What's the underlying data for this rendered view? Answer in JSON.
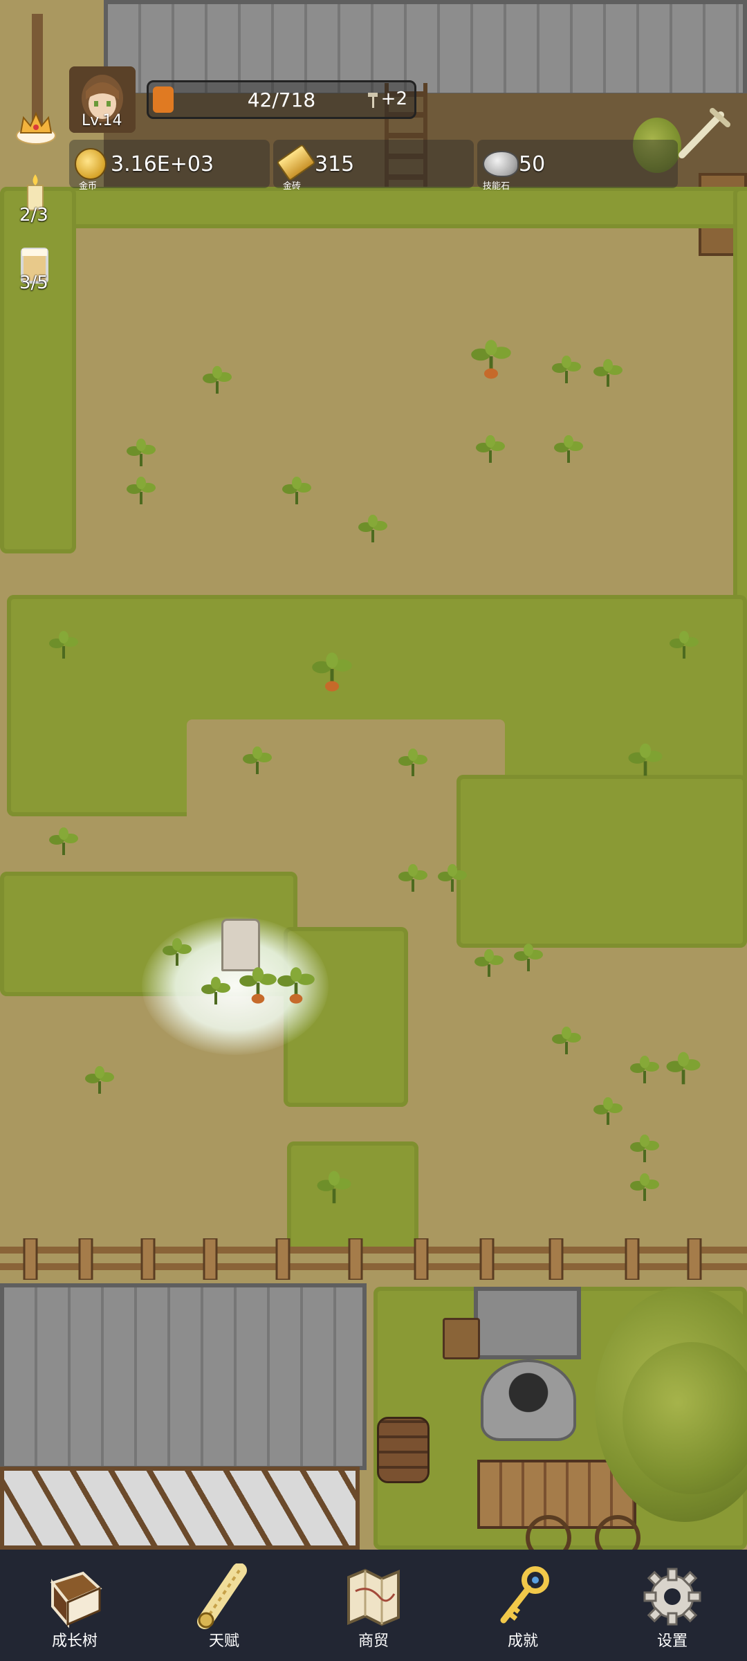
{
  "player": {
    "level_label": "Lv.14",
    "xp_text": "42/718",
    "xp_progress": 0.0585,
    "bonus_text": "+2"
  },
  "resources": [
    {
      "icon": "gold-coin-icon",
      "value": "3.16E+03",
      "caption": "金币"
    },
    {
      "icon": "gold-brick-icon",
      "value": "315",
      "caption": "金砖"
    },
    {
      "icon": "skill-stone-icon",
      "value": "50",
      "caption": "技能石"
    }
  ],
  "side_counters": [
    {
      "icon": "crown-icon"
    },
    {
      "icon": "candle-icon",
      "value": "2/3"
    },
    {
      "icon": "beer-mug-icon",
      "value": "3/5"
    }
  ],
  "nav": [
    {
      "icon": "book-icon",
      "label": "成长树"
    },
    {
      "icon": "scroll-icon",
      "label": "天赋"
    },
    {
      "icon": "map-icon",
      "label": "商贸"
    },
    {
      "icon": "key-icon",
      "label": "成就"
    },
    {
      "icon": "gear-icon",
      "label": "设置"
    }
  ],
  "colors": {
    "grass": "#8a9a35",
    "dirt": "#aa9860",
    "nav_bg": "#222633",
    "xp_fill": "#e07a22"
  }
}
